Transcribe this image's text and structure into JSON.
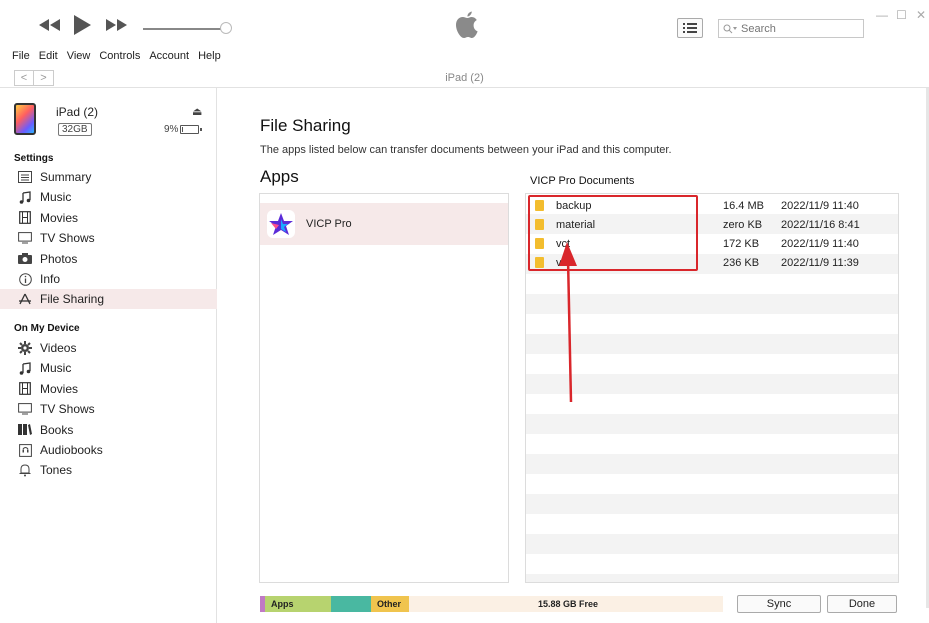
{
  "window": {
    "search_placeholder": "Search",
    "controls": [
      "—",
      "☐",
      "✕"
    ]
  },
  "menu": [
    "File",
    "Edit",
    "View",
    "Controls",
    "Account",
    "Help"
  ],
  "nav": {
    "back": "<",
    "forward": ">",
    "breadcrumb": "iPad (2)"
  },
  "device": {
    "name": "iPad (2)",
    "capacity": "32GB",
    "battery": "9%",
    "battery_level": 0.09
  },
  "sidebar": {
    "settings_title": "Settings",
    "settings_items": [
      {
        "label": "Summary",
        "icon": "summary-icon"
      },
      {
        "label": "Music",
        "icon": "music-icon"
      },
      {
        "label": "Movies",
        "icon": "movies-icon"
      },
      {
        "label": "TV Shows",
        "icon": "tv-icon"
      },
      {
        "label": "Photos",
        "icon": "camera-icon"
      },
      {
        "label": "Info",
        "icon": "info-icon"
      },
      {
        "label": "File Sharing",
        "icon": "apps-icon",
        "selected": true
      }
    ],
    "device_title": "On My Device",
    "device_items": [
      {
        "label": "Videos",
        "icon": "gear-icon"
      },
      {
        "label": "Music",
        "icon": "music-icon"
      },
      {
        "label": "Movies",
        "icon": "movies-icon"
      },
      {
        "label": "TV Shows",
        "icon": "tv-icon"
      },
      {
        "label": "Books",
        "icon": "book-icon"
      },
      {
        "label": "Audiobooks",
        "icon": "audiobook-icon"
      },
      {
        "label": "Tones",
        "icon": "bell-icon"
      }
    ]
  },
  "content": {
    "title": "File Sharing",
    "subtitle": "The apps listed below can transfer documents between your iPad and this computer.",
    "apps_heading": "Apps",
    "docs_heading": "VICP Pro Documents",
    "apps": [
      {
        "name": "VICP Pro",
        "icon": "star-app-icon"
      }
    ],
    "documents": [
      {
        "name": "backup",
        "size": "16.4 MB",
        "date": "2022/11/9 11:40"
      },
      {
        "name": "material",
        "size": "zero KB",
        "date": "2022/11/16 8:41"
      },
      {
        "name": "vct",
        "size": "172 KB",
        "date": "2022/11/9 11:40"
      },
      {
        "name": "vn",
        "size": "236 KB",
        "date": "2022/11/9 11:39"
      }
    ]
  },
  "storage": {
    "apps_label": "Apps",
    "other_label": "Other",
    "free_label": "15.88 GB Free",
    "colors": {
      "apps": "#b7d36f",
      "teal": "#49b8a1",
      "other": "#f0c44e",
      "purple": "#c07ac5",
      "free": "#fbf0e4"
    }
  },
  "buttons": {
    "sync": "Sync",
    "done": "Done"
  },
  "annotation": {
    "color": "#d9262b"
  }
}
